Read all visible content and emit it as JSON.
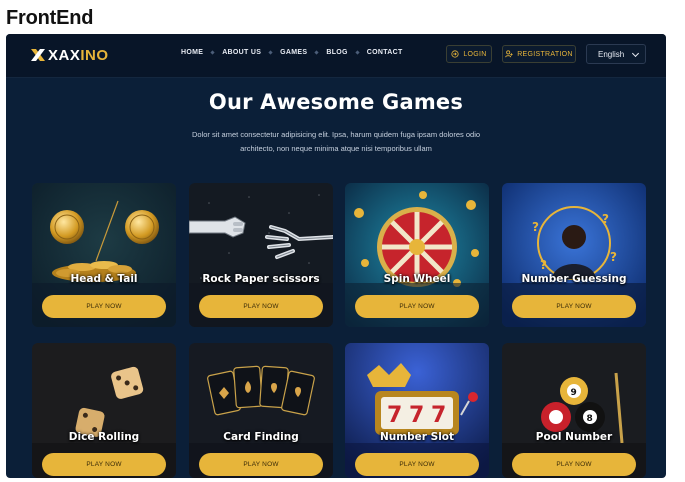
{
  "page_label": "FrontEnd",
  "brand": {
    "logo_prefix": "XAX",
    "logo_suffix": "INO",
    "accent": "#e7b53a",
    "background": "#0b1f38"
  },
  "nav": {
    "links": [
      "HOME",
      "ABOUT US",
      "GAMES",
      "BLOG",
      "CONTACT"
    ],
    "login_label": "LOGIN",
    "register_label": "REGISTRATION",
    "language": "English"
  },
  "hero": {
    "title": "Our Awesome Games",
    "subtitle": "Dolor sit amet consectetur adipisicing elit. Ipsa, harum quidem fuga ipsam dolores odio architecto, non neque minima atque nisi temporibus ullam"
  },
  "games": [
    {
      "title": "Head & Tail",
      "icon": "gold-coins-icon",
      "button": "PLAY NOW"
    },
    {
      "title": "Rock Paper scissors",
      "icon": "robot-hands-icon",
      "button": "PLAY NOW"
    },
    {
      "title": "Spin Wheel",
      "icon": "roulette-wheel-icon",
      "button": "PLAY NOW"
    },
    {
      "title": "Number Guessing",
      "icon": "thinking-person-icon",
      "button": "PLAY NOW"
    },
    {
      "title": "Dice Rolling",
      "icon": "dice-icon",
      "button": "PLAY NOW"
    },
    {
      "title": "Card Finding",
      "icon": "playing-cards-icon",
      "button": "PLAY NOW"
    },
    {
      "title": "Number Slot",
      "icon": "slot-machine-icon",
      "button": "PLAY NOW"
    },
    {
      "title": "Pool Number",
      "icon": "billiard-balls-icon",
      "button": "PLAY NOW"
    }
  ]
}
